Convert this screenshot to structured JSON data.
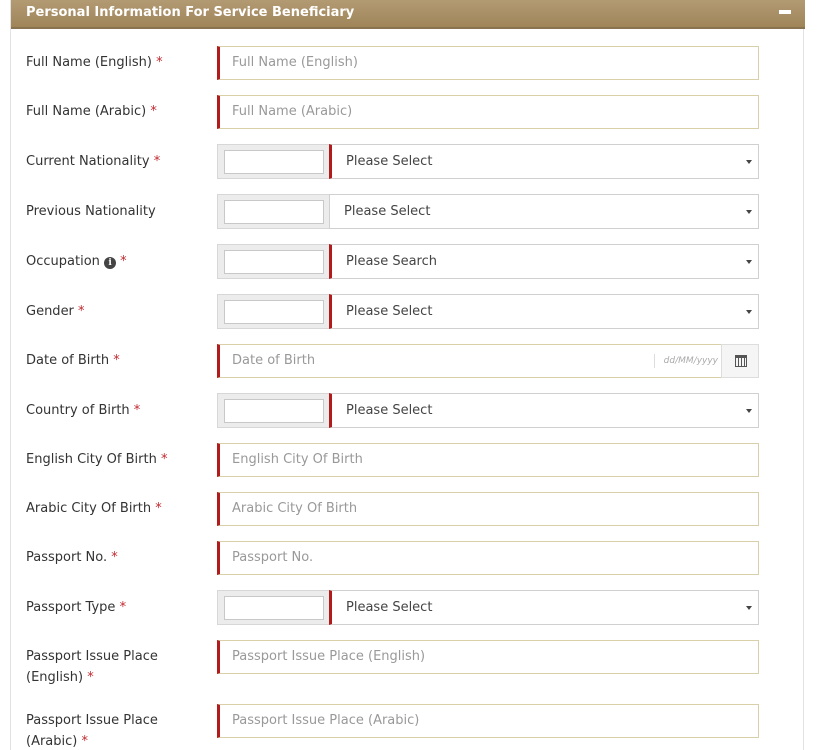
{
  "panel": {
    "title": "Personal Information For Service Beneficiary",
    "collapse_icon": "minus-icon"
  },
  "fields": {
    "full_name_en": {
      "label": "Full Name (English)",
      "required": "*",
      "placeholder": "Full Name (English)"
    },
    "full_name_ar": {
      "label": "Full Name (Arabic)",
      "required": "*",
      "placeholder": "Full Name (Arabic)"
    },
    "current_nationality": {
      "label": "Current Nationality",
      "required": "*",
      "selected": "Please Select"
    },
    "previous_nationality": {
      "label": "Previous Nationality",
      "selected": "Please Select"
    },
    "occupation": {
      "label": "Occupation",
      "info_icon": "i",
      "required": "*",
      "selected": "Please Search"
    },
    "gender": {
      "label": "Gender",
      "required": "*",
      "selected": "Please Select"
    },
    "date_of_birth": {
      "label": "Date of Birth",
      "required": "*",
      "placeholder": "Date of Birth",
      "format_hint": "dd/MM/yyyy",
      "icon": "calendar-icon"
    },
    "country_of_birth": {
      "label": "Country of Birth",
      "required": "*",
      "selected": "Please Select"
    },
    "english_city_of_birth": {
      "label": "English City Of Birth",
      "required": "*",
      "placeholder": "English City Of Birth"
    },
    "arabic_city_of_birth": {
      "label": "Arabic City Of Birth",
      "required": "*",
      "placeholder": "Arabic City Of Birth"
    },
    "passport_no": {
      "label": "Passport No.",
      "required": "*",
      "placeholder": "Passport No."
    },
    "passport_type": {
      "label": "Passport Type",
      "required": "*",
      "selected": "Please Select"
    },
    "passport_issue_place_en": {
      "label_line1": "Passport Issue Place",
      "label_line2": "(English)",
      "required": "*",
      "placeholder": "Passport Issue Place (English)"
    },
    "passport_issue_place_ar": {
      "label_line1": "Passport Issue Place",
      "label_line2": "(Arabic)",
      "required": "*",
      "placeholder": "Passport Issue Place (Arabic)"
    }
  },
  "colors": {
    "header_bg": "#a08559",
    "required": "#c0272d",
    "input_accent": "#b11b1b"
  }
}
